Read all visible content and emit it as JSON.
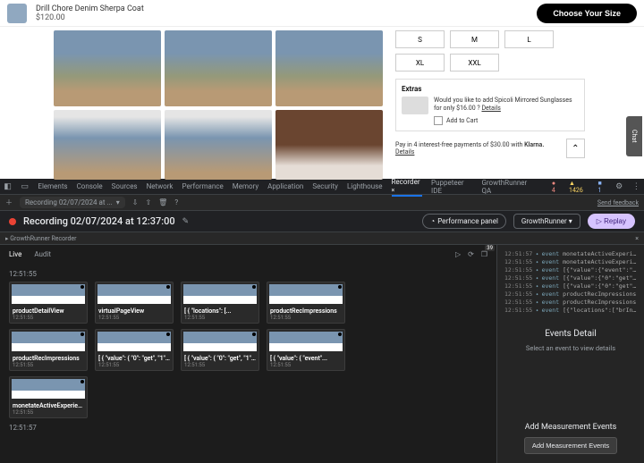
{
  "top": {
    "title": "Drill Chore Denim Sherpa Coat",
    "price": "$120.00",
    "cta": "Choose Your Size"
  },
  "sizes": [
    "S",
    "M",
    "L",
    "XL",
    "XXL"
  ],
  "extras": {
    "title": "Extras",
    "text_pre": "Would you like to add Spicoli Mirrored Sunglasses for only $16.00 ? ",
    "details": "Details",
    "add": "Add to Cart"
  },
  "klarna": {
    "pre": "Pay in 4 interest-free payments of $30.00 with ",
    "brand": "Klarna.",
    "details": "Details"
  },
  "chat": "Chat",
  "devtools": {
    "tabs": [
      "Elements",
      "Console",
      "Sources",
      "Network",
      "Performance",
      "Memory",
      "Application",
      "Security",
      "Lighthouse",
      "Recorder",
      "Puppeteer IDE",
      "GrowthRunner QA"
    ],
    "warn": "▲ 1426",
    "err": "● 4",
    "info": "■ 1",
    "feedback": "Send feedback"
  },
  "toolbar": {
    "chip": "Recording 02/07/2024 at ..."
  },
  "recorder": {
    "title": "Recording 02/07/2024 at 12:37:00",
    "perf": "Performance panel",
    "runner": "GrowthRunner",
    "replay": "▷ Replay",
    "sub": "GrowthRunner Recorder"
  },
  "timeline": {
    "tabs": {
      "live": "Live",
      "audit": "Audit"
    },
    "ts1": "12:51:55",
    "ts2": "12:51:57",
    "badge": "39",
    "rows": [
      [
        {
          "t": "productDetailView",
          "ts": "12:51:55"
        },
        {
          "t": "virtualPageView",
          "ts": "12:51:55"
        },
        {
          "t": "[ { \"locations\": [...",
          "ts": "12:51:55"
        },
        {
          "t": "productRecImpressions",
          "ts": "12:51:55"
        }
      ],
      [
        {
          "t": "productRecImpressions",
          "ts": "12:51:55"
        },
        {
          "t": "[ { \"value\": { \"0\": \"get\", \"1\":...",
          "ts": "12:51:55"
        },
        {
          "t": "[ { \"value\": { \"0\": \"get\", \"1\":...",
          "ts": "12:51:55"
        },
        {
          "t": "[ { \"value\": { \"event\"...",
          "ts": "12:51:55"
        }
      ],
      [
        {
          "t": "monetateActiveExperiences",
          "ts": "12:51:55"
        }
      ]
    ]
  },
  "log": [
    {
      "t": "12:51:57",
      "e": "event",
      "m": "monetateActiveExperiences"
    },
    {
      "t": "12:51:55",
      "e": "event",
      "m": "monetateActiveExperiences"
    },
    {
      "t": "12:51:55",
      "e": "event",
      "m": "[{\"value\":{\"event\":\"gtag4..."
    },
    {
      "t": "12:51:55",
      "e": "event",
      "m": "[{\"value\":{\"0\":\"get\",\"1\":..."
    },
    {
      "t": "12:51:55",
      "e": "event",
      "m": "[{\"value\":{\"0\":\"get\",\"1\":..."
    },
    {
      "t": "12:51:55",
      "e": "event",
      "m": "productRecImpressions"
    },
    {
      "t": "12:51:55",
      "e": "event",
      "m": "productRecImpressions"
    },
    {
      "t": "12:51:55",
      "e": "event",
      "m": "[{\"locations\":[\"brInterna..."
    }
  ],
  "side": {
    "detail_h": "Events Detail",
    "detail_p": "Select an event to view details",
    "add_h": "Add Measurement Events",
    "add_btn": "Add Measurement Events"
  }
}
